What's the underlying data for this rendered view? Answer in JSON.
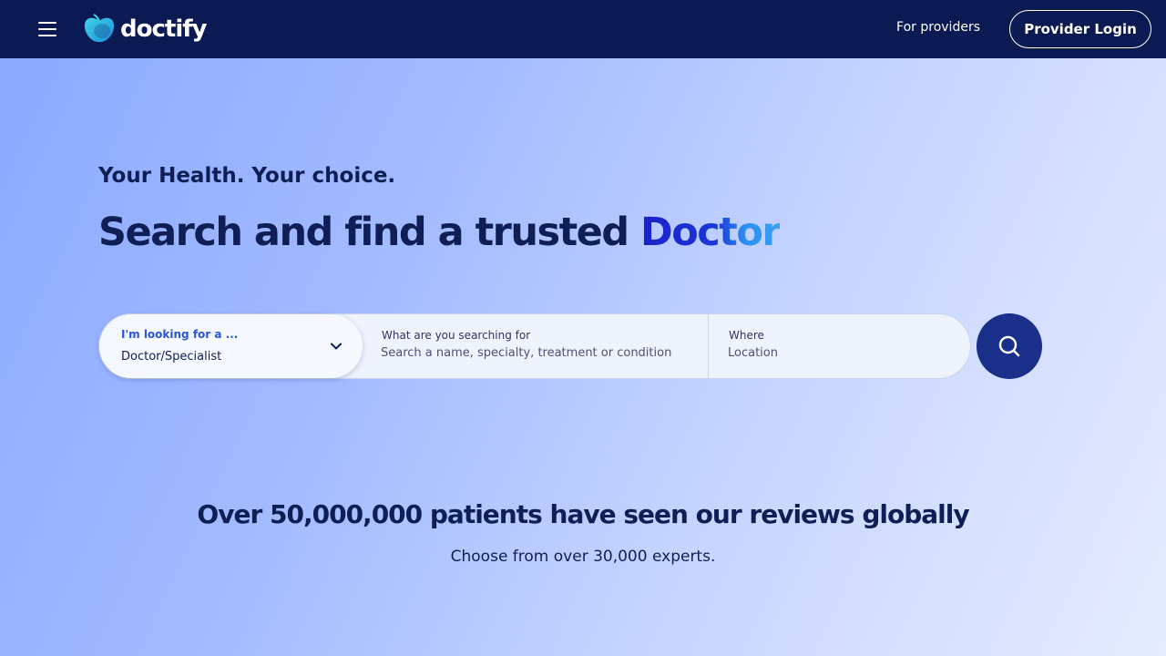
{
  "header": {
    "brand": "doctify",
    "for_providers_label": "For providers",
    "login_label": "Provider Login"
  },
  "hero": {
    "tagline": "Your Health. Your choice.",
    "headline_prefix": "Search and find a trusted ",
    "headline_accent": "Doctor"
  },
  "search": {
    "type_label": "I'm looking for a ...",
    "type_value": "Doctor/Specialist",
    "what_label": "What are you searching for",
    "what_placeholder": "Search a name, specialty, treatment or condition",
    "where_label": "Where",
    "where_placeholder": "Location"
  },
  "stats": {
    "title": "Over 50,000,000 patients have seen our reviews globally",
    "subtitle": "Choose from over 30,000 experts."
  },
  "colors": {
    "nav_bg": "#0b1a52",
    "accent": "#1b21c9",
    "search_button": "#1a2f8a"
  }
}
